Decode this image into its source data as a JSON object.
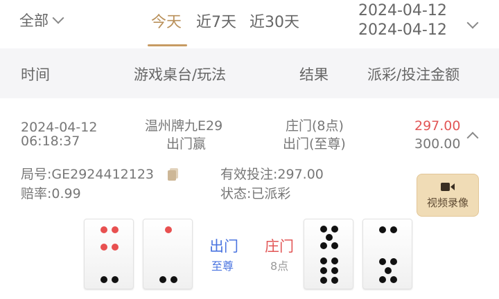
{
  "filter": {
    "all_label": "全部",
    "tabs": [
      {
        "label": "今天",
        "active": true
      },
      {
        "label": "近7天",
        "active": false
      },
      {
        "label": "近30天",
        "active": false
      }
    ],
    "date_start": "2024-04-12",
    "date_end": "2024-04-12"
  },
  "header": {
    "time": "时间",
    "table": "游戏桌台/玩法",
    "result": "结果",
    "payout": "派彩/投注金额"
  },
  "record": {
    "date": "2024-04-12",
    "time": "06:18:37",
    "table": "温州牌九E29",
    "play": "出门赢",
    "result_banker": "庄门(8点)",
    "result_player": "出门(至尊)",
    "payout": "297.00",
    "bet": "300.00",
    "round_no": "局号:GE2924412123",
    "valid_bet": "有效投注:297.00",
    "odds": "赔率:0.99",
    "status": "状态:已派彩",
    "video_label": "视频录像"
  },
  "hands": {
    "player": {
      "name": "出门",
      "desc": "至尊",
      "tiles": [
        "tile-2-4",
        "tile-1-2"
      ]
    },
    "banker": {
      "name": "庄门",
      "desc": "8点",
      "tiles": [
        "tile-2-6",
        "tile-2-4"
      ]
    }
  },
  "colors": {
    "accent": "#c79b63",
    "red": "#e25656",
    "blue": "#4a74e0",
    "header_bg": "#f5f5f7"
  }
}
